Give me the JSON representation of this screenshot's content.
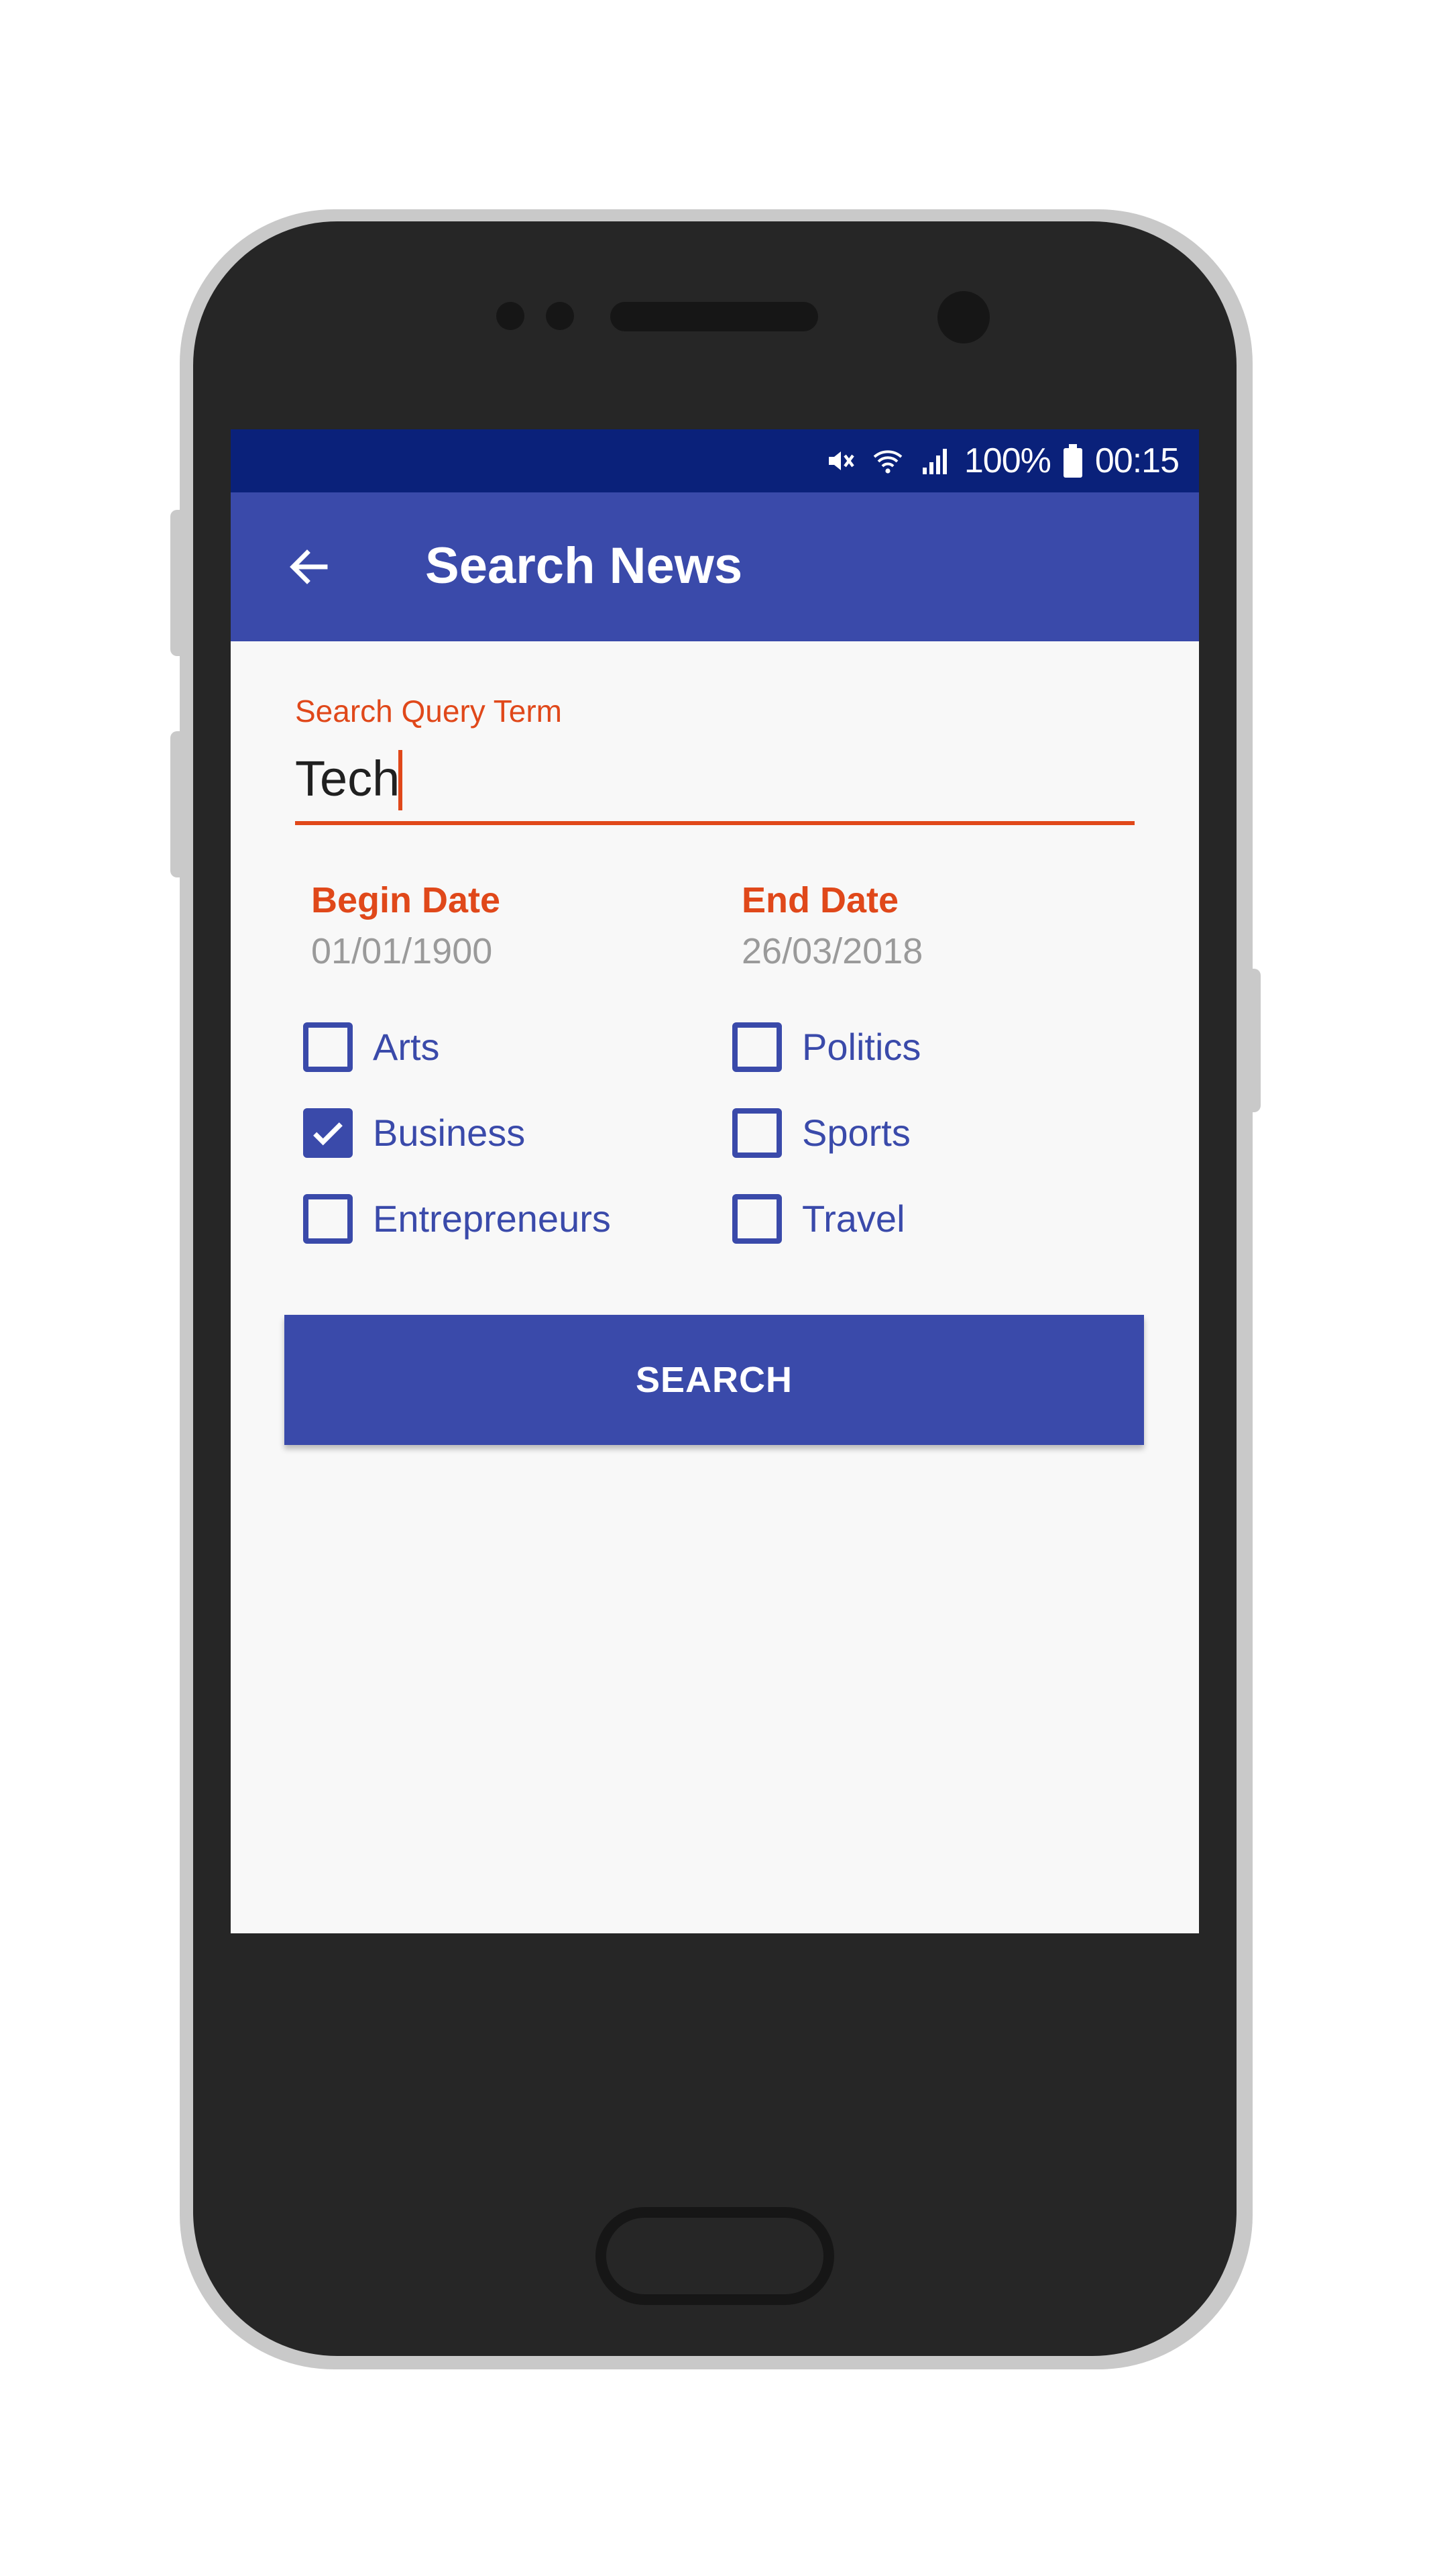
{
  "status_bar": {
    "battery_percent": "100%",
    "time": "00:15",
    "icons": [
      "mute-icon",
      "wifi-icon",
      "signal-icon",
      "battery-icon"
    ]
  },
  "app_bar": {
    "title": "Search News",
    "back_icon": "arrow-left-icon"
  },
  "search": {
    "label": "Search Query Term",
    "value": "Tech"
  },
  "dates": {
    "begin_label": "Begin Date",
    "begin_value": "01/01/1900",
    "end_label": "End Date",
    "end_value": "26/03/2018"
  },
  "categories": [
    {
      "label": "Arts",
      "checked": false
    },
    {
      "label": "Business",
      "checked": true
    },
    {
      "label": "Entrepreneurs",
      "checked": false
    },
    {
      "label": "Politics",
      "checked": false
    },
    {
      "label": "Sports",
      "checked": false
    },
    {
      "label": "Travel",
      "checked": false
    }
  ],
  "search_button": {
    "label": "SEARCH"
  },
  "colors": {
    "primary": "#3a4aaa",
    "status_bar": "#0a217a",
    "accent": "#e0481a"
  }
}
